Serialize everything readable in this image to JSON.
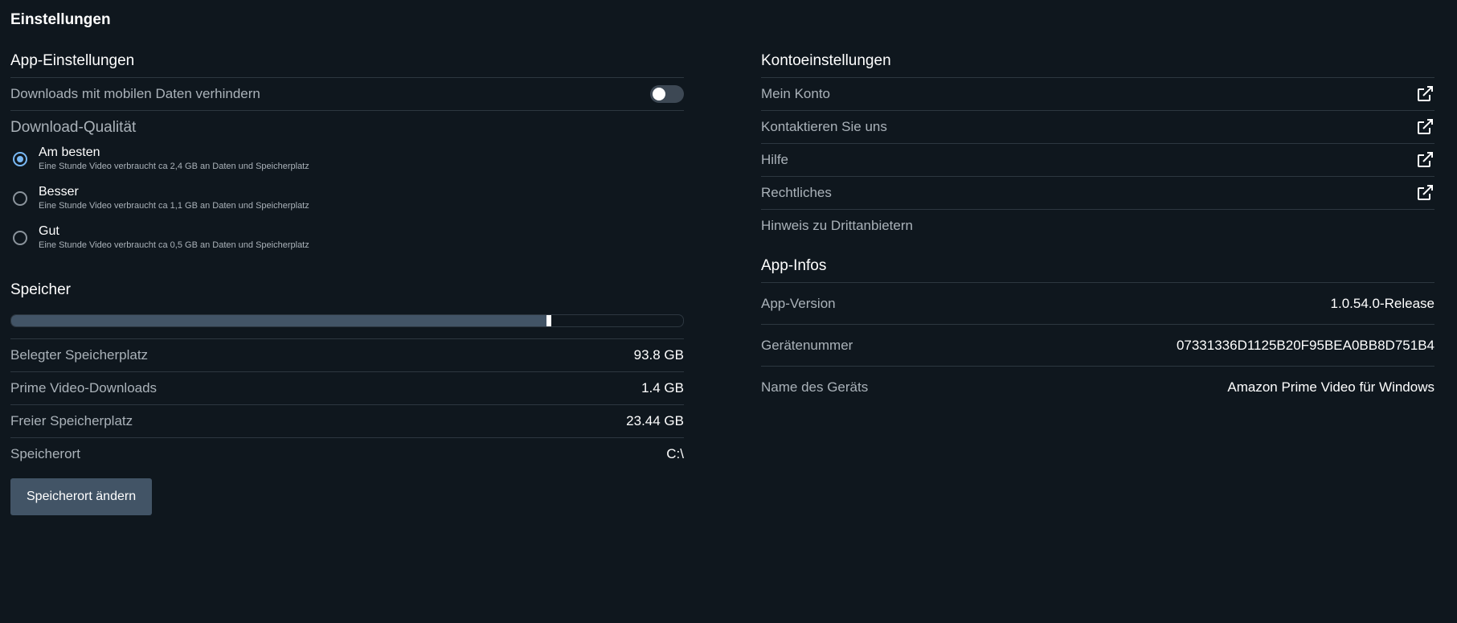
{
  "page_title": "Einstellungen",
  "app_settings": {
    "title": "App-Einstellungen",
    "mobile_data_label": "Downloads mit mobilen Daten verhindern",
    "mobile_data_enabled": false,
    "quality_title": "Download-Qualität",
    "quality_options": [
      {
        "label": "Am besten",
        "desc": "Eine Stunde Video verbraucht ca 2,4 GB an Daten und Speicherplatz",
        "selected": true
      },
      {
        "label": "Besser",
        "desc": "Eine Stunde Video verbraucht ca 1,1 GB an Daten und Speicherplatz",
        "selected": false
      },
      {
        "label": "Gut",
        "desc": "Eine Stunde Video verbraucht ca 0,5 GB an Daten und Speicherplatz",
        "selected": false
      }
    ]
  },
  "storage": {
    "title": "Speicher",
    "used_fraction": 0.8,
    "rows": [
      {
        "label": "Belegter Speicherplatz",
        "value": "93.8 GB"
      },
      {
        "label": "Prime Video-Downloads",
        "value": "1.4 GB"
      },
      {
        "label": "Freier Speicherplatz",
        "value": "23.44 GB"
      },
      {
        "label": "Speicherort",
        "value": "C:\\"
      }
    ],
    "change_button": "Speicherort ändern"
  },
  "account": {
    "title": "Kontoeinstellungen",
    "links": [
      {
        "label": "Mein Konto",
        "icon": "external-link-icon"
      },
      {
        "label": "Kontaktieren Sie uns",
        "icon": "external-link-icon"
      },
      {
        "label": "Hilfe",
        "icon": "external-link-icon"
      },
      {
        "label": "Rechtliches",
        "icon": "external-link-icon"
      },
      {
        "label": "Hinweis zu Drittanbietern",
        "icon": ""
      }
    ]
  },
  "app_info": {
    "title": "App-Infos",
    "rows": [
      {
        "label": "App-Version",
        "value": "1.0.54.0-Release"
      },
      {
        "label": "Gerätenummer",
        "value": "07331336D1125B20F95BEA0BB8D751B4"
      },
      {
        "label": "Name des Geräts",
        "value": "Amazon Prime Video für Windows"
      }
    ]
  },
  "colors": {
    "background": "#0f171e",
    "accent": "#79b8f3",
    "button": "#425466"
  }
}
